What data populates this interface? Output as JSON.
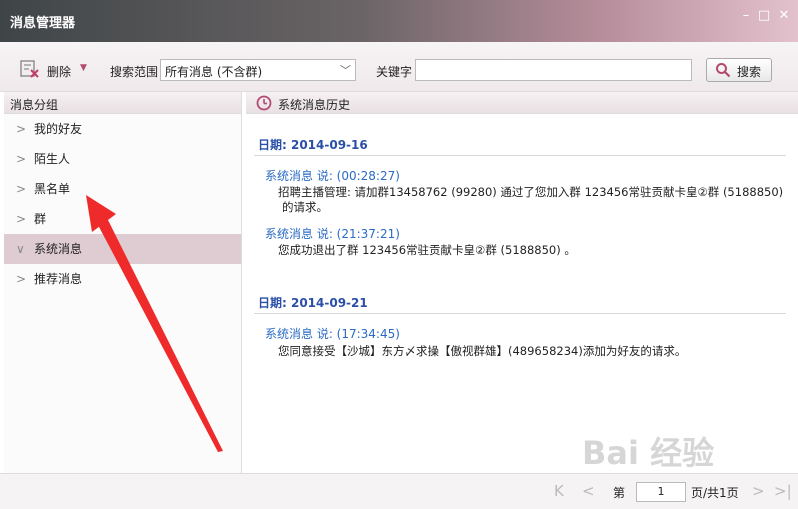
{
  "window": {
    "title": "消息管理器",
    "minimize": "–",
    "maximize": "□",
    "close": "✕"
  },
  "toolbar": {
    "delete_label": "删除",
    "scope_label": "搜索范围",
    "scope_value": "所有消息 (不含群)",
    "keyword_label": "关键字",
    "keyword_value": "",
    "search_label": "搜索"
  },
  "sidebar": {
    "title": "消息分组",
    "items": [
      {
        "label": "我的好友"
      },
      {
        "label": "陌生人"
      },
      {
        "label": "黑名单"
      },
      {
        "label": "群"
      },
      {
        "label": "系统消息"
      },
      {
        "label": "推荐消息"
      }
    ]
  },
  "main": {
    "title": "系统消息历史",
    "groups": [
      {
        "date": "日期:  2014-09-16",
        "messages": [
          {
            "head": "系统消息  说:  (00:28:27)",
            "body1": "招聘主播管理: 请加群13458762 (99280)  通过了您加入群 123456常驻贡献卡皇②群 (5188850)",
            "body2": "的请求。"
          },
          {
            "head": "系统消息  说:  (21:37:21)",
            "body1": "您成功退出了群 123456常驻贡献卡皇②群 (5188850) 。",
            "body2": ""
          }
        ]
      },
      {
        "date": "日期:  2014-09-21",
        "messages": [
          {
            "head": "系统消息  说:  (17:34:45)",
            "body1": "您同意接受【沙城】东方〆求操【傲视群雄】(489658234)添加为好友的请求。",
            "body2": ""
          }
        ]
      }
    ]
  },
  "footer": {
    "first": "K",
    "prev": "<",
    "page_prefix": "第",
    "page_value": "1",
    "page_suffix": "页/共1页",
    "next": ">",
    "last": ">|"
  },
  "watermark": "Bai 经验",
  "colors": {
    "accent": "#b24a72",
    "link_blue": "#2b6bc5",
    "annotation_arrow": "#ee2a2a"
  }
}
